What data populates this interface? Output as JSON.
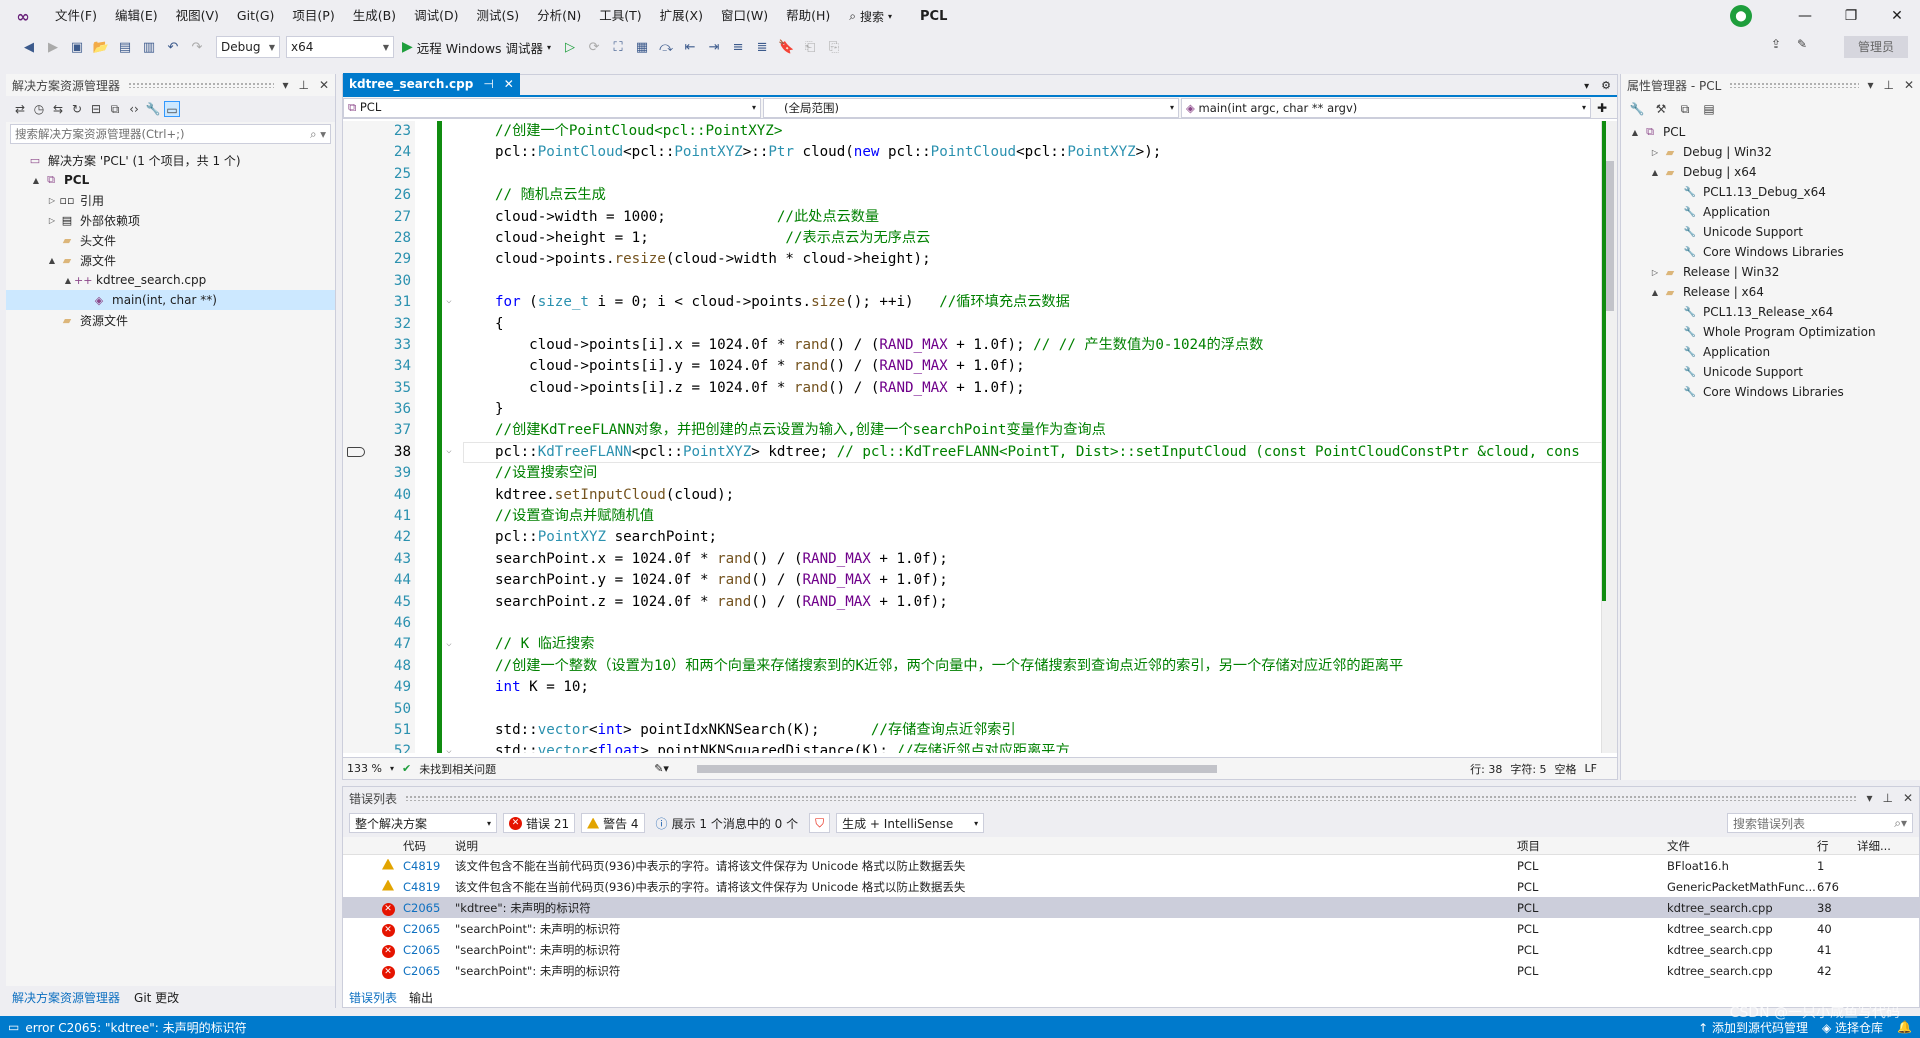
{
  "menu": {
    "items": [
      "文件(F)",
      "编辑(E)",
      "视图(V)",
      "Git(G)",
      "项目(P)",
      "生成(B)",
      "调试(D)",
      "测试(S)",
      "分析(N)",
      "工具(T)",
      "扩展(X)",
      "窗口(W)",
      "帮助(H)"
    ],
    "search_label": "搜索",
    "title": "PCL"
  },
  "toolbar": {
    "config": "Debug",
    "platform": "x64",
    "run_label": "远程 Windows 调试器",
    "manage_label": "管理员"
  },
  "solution_explorer": {
    "title": "解决方案资源管理器",
    "search_placeholder": "搜索解决方案资源管理器(Ctrl+;)",
    "tree": [
      {
        "label": "解决方案 'PCL' (1 个项目，共 1 个)",
        "indent": 0,
        "twisty": "",
        "icon": "solution-icon",
        "glyph": "▭",
        "bold": false
      },
      {
        "label": "PCL",
        "indent": 1,
        "twisty": "▲",
        "icon": "project-icon",
        "glyph": "⧉",
        "bold": true
      },
      {
        "label": "引用",
        "indent": 2,
        "twisty": "▷",
        "icon": "references-icon",
        "glyph": "▫▫",
        "bold": false
      },
      {
        "label": "外部依赖项",
        "indent": 2,
        "twisty": "▷",
        "icon": "external-deps-icon",
        "glyph": "▤",
        "bold": false
      },
      {
        "label": "头文件",
        "indent": 2,
        "twisty": "",
        "icon": "folder-icon",
        "glyph": "▰",
        "bold": false
      },
      {
        "label": "源文件",
        "indent": 2,
        "twisty": "▲",
        "icon": "folder-icon",
        "glyph": "▰",
        "bold": false
      },
      {
        "label": "kdtree_search.cpp",
        "indent": 3,
        "twisty": "▲",
        "icon": "cpp-file-icon",
        "glyph": "++",
        "bold": false
      },
      {
        "label": "main(int, char **)",
        "indent": 4,
        "twisty": "",
        "icon": "method-icon",
        "glyph": "◈",
        "bold": false,
        "selected": true
      },
      {
        "label": "资源文件",
        "indent": 2,
        "twisty": "",
        "icon": "folder-icon",
        "glyph": "▰",
        "bold": false
      }
    ],
    "bottom_tabs": [
      "解决方案资源管理器",
      "Git 更改"
    ]
  },
  "editor": {
    "tab_label": "kdtree_search.cpp",
    "nav_project": "PCL",
    "nav_scope": "(全局范围)",
    "nav_member": "main(int argc, char ** argv)",
    "current_line": 38,
    "lines": [
      {
        "n": 23,
        "fold": "",
        "segs": [
          [
            "cm",
            "//创建一个PointCloud<pcl::PointXYZ>"
          ]
        ]
      },
      {
        "n": 24,
        "fold": "",
        "segs": [
          [
            "nm",
            "pcl::"
          ],
          [
            "ty",
            "PointCloud"
          ],
          [
            "nm",
            "<pcl::"
          ],
          [
            "ty",
            "PointXYZ"
          ],
          [
            "nm",
            ">::"
          ],
          [
            "ty",
            "Ptr"
          ],
          [
            "nm",
            " cloud("
          ],
          [
            "kw",
            "new"
          ],
          [
            "nm",
            " pcl::"
          ],
          [
            "ty",
            "PointCloud"
          ],
          [
            "nm",
            "<pcl::"
          ],
          [
            "ty",
            "PointXYZ"
          ],
          [
            "nm",
            ">);"
          ]
        ]
      },
      {
        "n": 25,
        "fold": "",
        "segs": [
          [
            "nm",
            ""
          ]
        ]
      },
      {
        "n": 26,
        "fold": "",
        "segs": [
          [
            "cm",
            "// 随机点云生成"
          ]
        ]
      },
      {
        "n": 27,
        "fold": "",
        "segs": [
          [
            "nm",
            "cloud->width = 1000;             "
          ],
          [
            "cm",
            "//此处点云数量"
          ]
        ]
      },
      {
        "n": 28,
        "fold": "",
        "segs": [
          [
            "nm",
            "cloud->height = 1;                "
          ],
          [
            "cm",
            "//表示点云为无序点云"
          ]
        ]
      },
      {
        "n": 29,
        "fold": "",
        "segs": [
          [
            "nm",
            "cloud->points."
          ],
          [
            "fn",
            "resize"
          ],
          [
            "nm",
            "(cloud->width * cloud->height);"
          ]
        ]
      },
      {
        "n": 30,
        "fold": "",
        "segs": [
          [
            "nm",
            ""
          ]
        ]
      },
      {
        "n": 31,
        "fold": "⌵",
        "segs": [
          [
            "kw",
            "for"
          ],
          [
            "nm",
            " ("
          ],
          [
            "ty",
            "size_t"
          ],
          [
            "nm",
            " i = 0; i < cloud->points."
          ],
          [
            "fn",
            "size"
          ],
          [
            "nm",
            "(); ++i)   "
          ],
          [
            "cm",
            "//循环填充点云数据"
          ]
        ]
      },
      {
        "n": 32,
        "fold": "",
        "segs": [
          [
            "nm",
            "{"
          ]
        ]
      },
      {
        "n": 33,
        "fold": "",
        "segs": [
          [
            "nm",
            "    cloud->points[i].x = 1024.0f * "
          ],
          [
            "fn",
            "rand"
          ],
          [
            "nm",
            "() / ("
          ],
          [
            "mc",
            "RAND_MAX"
          ],
          [
            "nm",
            " + 1.0f); "
          ],
          [
            "cm",
            "// // 产生数值为0-1024的浮点数"
          ]
        ]
      },
      {
        "n": 34,
        "fold": "",
        "segs": [
          [
            "nm",
            "    cloud->points[i].y = 1024.0f * "
          ],
          [
            "fn",
            "rand"
          ],
          [
            "nm",
            "() / ("
          ],
          [
            "mc",
            "RAND_MAX"
          ],
          [
            "nm",
            " + 1.0f);"
          ]
        ]
      },
      {
        "n": 35,
        "fold": "",
        "segs": [
          [
            "nm",
            "    cloud->points[i].z = 1024.0f * "
          ],
          [
            "fn",
            "rand"
          ],
          [
            "nm",
            "() / ("
          ],
          [
            "mc",
            "RAND_MAX"
          ],
          [
            "nm",
            " + 1.0f);"
          ]
        ]
      },
      {
        "n": 36,
        "fold": "",
        "segs": [
          [
            "nm",
            "}"
          ]
        ]
      },
      {
        "n": 37,
        "fold": "",
        "segs": [
          [
            "cm",
            "//创建KdTreeFLANN对象，并把创建的点云设置为输入,创建一个searchPoint变量作为查询点"
          ]
        ]
      },
      {
        "n": 38,
        "fold": "⌵",
        "segs": [
          [
            "nm",
            "pcl::"
          ],
          [
            "ty",
            "KdTreeFLANN"
          ],
          [
            "nm",
            "<pcl::"
          ],
          [
            "ty",
            "PointXYZ"
          ],
          [
            "nm",
            "> kdtree; "
          ],
          [
            "cm",
            "// pcl::KdTreeFLANN<PointT, Dist>::setInputCloud (const PointCloudConstPtr &cloud, cons"
          ]
        ]
      },
      {
        "n": 39,
        "fold": "",
        "segs": [
          [
            "cm",
            "//设置搜索空间"
          ]
        ]
      },
      {
        "n": 40,
        "fold": "",
        "segs": [
          [
            "nm",
            "kdtree."
          ],
          [
            "fn",
            "setInputCloud"
          ],
          [
            "nm",
            "(cloud);"
          ]
        ]
      },
      {
        "n": 41,
        "fold": "",
        "segs": [
          [
            "cm",
            "//设置查询点并赋随机值"
          ]
        ]
      },
      {
        "n": 42,
        "fold": "",
        "segs": [
          [
            "nm",
            "pcl::"
          ],
          [
            "ty",
            "PointXYZ"
          ],
          [
            "nm",
            " searchPoint;"
          ]
        ]
      },
      {
        "n": 43,
        "fold": "",
        "segs": [
          [
            "nm",
            "searchPoint.x = 1024.0f * "
          ],
          [
            "fn",
            "rand"
          ],
          [
            "nm",
            "() / ("
          ],
          [
            "mc",
            "RAND_MAX"
          ],
          [
            "nm",
            " + 1.0f);"
          ]
        ]
      },
      {
        "n": 44,
        "fold": "",
        "segs": [
          [
            "nm",
            "searchPoint.y = 1024.0f * "
          ],
          [
            "fn",
            "rand"
          ],
          [
            "nm",
            "() / ("
          ],
          [
            "mc",
            "RAND_MAX"
          ],
          [
            "nm",
            " + 1.0f);"
          ]
        ]
      },
      {
        "n": 45,
        "fold": "",
        "segs": [
          [
            "nm",
            "searchPoint.z = 1024.0f * "
          ],
          [
            "fn",
            "rand"
          ],
          [
            "nm",
            "() / ("
          ],
          [
            "mc",
            "RAND_MAX"
          ],
          [
            "nm",
            " + 1.0f);"
          ]
        ]
      },
      {
        "n": 46,
        "fold": "",
        "segs": [
          [
            "nm",
            ""
          ]
        ]
      },
      {
        "n": 47,
        "fold": "⌵",
        "segs": [
          [
            "cm",
            "// K 临近搜索"
          ]
        ]
      },
      {
        "n": 48,
        "fold": "",
        "segs": [
          [
            "cm",
            "//创建一个整数（设置为10）和两个向量来存储搜索到的K近邻，两个向量中，一个存储搜索到查询点近邻的索引，另一个存储对应近邻的距离平"
          ]
        ]
      },
      {
        "n": 49,
        "fold": "",
        "segs": [
          [
            "kw",
            "int"
          ],
          [
            "nm",
            " K = 10;"
          ]
        ]
      },
      {
        "n": 50,
        "fold": "",
        "segs": [
          [
            "nm",
            ""
          ]
        ]
      },
      {
        "n": 51,
        "fold": "",
        "segs": [
          [
            "nm",
            "std::"
          ],
          [
            "ty",
            "vector"
          ],
          [
            "nm",
            "<"
          ],
          [
            "kw",
            "int"
          ],
          [
            "nm",
            "> pointIdxNKNSearch(K);      "
          ],
          [
            "cm",
            "//存储查询点近邻索引"
          ]
        ]
      },
      {
        "n": 52,
        "fold": "⌵",
        "segs": [
          [
            "nm",
            "std::"
          ],
          [
            "ty",
            "vector"
          ],
          [
            "nm",
            "<"
          ],
          [
            "kw",
            "float"
          ],
          [
            "nm",
            "> pointNKNSquaredDistance(K); "
          ],
          [
            "cm",
            "//存储近邻点对应距离平方"
          ]
        ]
      }
    ],
    "status": {
      "zoom": "133 %",
      "issues": "未找到相关问题",
      "row": "行: 38",
      "col": "字符: 5",
      "indent": "空格",
      "eol": "LF"
    }
  },
  "properties": {
    "title": "属性管理器 - PCL",
    "tree": [
      {
        "label": "PCL",
        "indent": 0,
        "twisty": "▲",
        "icon": "project-icon",
        "glyph": "⧉"
      },
      {
        "label": "Debug | Win32",
        "indent": 1,
        "twisty": "▷",
        "icon": "folder-icon",
        "glyph": "▰"
      },
      {
        "label": "Debug | x64",
        "indent": 1,
        "twisty": "▲",
        "icon": "folder-icon",
        "glyph": "▰"
      },
      {
        "label": "PCL1.13_Debug_x64",
        "indent": 2,
        "twisty": "",
        "icon": "wrench-icon",
        "glyph": "🔧"
      },
      {
        "label": "Application",
        "indent": 2,
        "twisty": "",
        "icon": "wrench-icon",
        "glyph": "🔧"
      },
      {
        "label": "Unicode Support",
        "indent": 2,
        "twisty": "",
        "icon": "wrench-icon",
        "glyph": "🔧"
      },
      {
        "label": "Core Windows Libraries",
        "indent": 2,
        "twisty": "",
        "icon": "wrench-icon",
        "glyph": "🔧"
      },
      {
        "label": "Release | Win32",
        "indent": 1,
        "twisty": "▷",
        "icon": "folder-icon",
        "glyph": "▰"
      },
      {
        "label": "Release | x64",
        "indent": 1,
        "twisty": "▲",
        "icon": "folder-icon",
        "glyph": "▰"
      },
      {
        "label": "PCL1.13_Release_x64",
        "indent": 2,
        "twisty": "",
        "icon": "wrench-icon",
        "glyph": "🔧"
      },
      {
        "label": "Whole Program Optimization",
        "indent": 2,
        "twisty": "",
        "icon": "wrench-icon",
        "glyph": "🔧"
      },
      {
        "label": "Application",
        "indent": 2,
        "twisty": "",
        "icon": "wrench-icon",
        "glyph": "🔧"
      },
      {
        "label": "Unicode Support",
        "indent": 2,
        "twisty": "",
        "icon": "wrench-icon",
        "glyph": "🔧"
      },
      {
        "label": "Core Windows Libraries",
        "indent": 2,
        "twisty": "",
        "icon": "wrench-icon",
        "glyph": "🔧"
      }
    ]
  },
  "errors": {
    "title": "错误列表",
    "scope": "整个解决方案",
    "errors_btn": "错误 21",
    "warnings_btn": "警告 4",
    "messages_btn": "展示 1 个消息中的 0 个",
    "source": "生成 + IntelliSense",
    "search_placeholder": "搜索错误列表",
    "headers": {
      "code": "代码",
      "desc": "说明",
      "project": "项目",
      "file": "文件",
      "line": "行",
      "detail": "详细..."
    },
    "rows": [
      {
        "type": "warning",
        "code": "C4819",
        "desc": "该文件包含不能在当前代码页(936)中表示的字符。请将该文件保存为 Unicode 格式以防止数据丢失",
        "project": "PCL",
        "file": "BFloat16.h",
        "line": "1"
      },
      {
        "type": "warning",
        "code": "C4819",
        "desc": "该文件包含不能在当前代码页(936)中表示的字符。请将该文件保存为 Unicode 格式以防止数据丢失",
        "project": "PCL",
        "file": "GenericPacketMathFunc...",
        "line": "676"
      },
      {
        "type": "error",
        "code": "C2065",
        "desc": "\"kdtree\": 未声明的标识符",
        "project": "PCL",
        "file": "kdtree_search.cpp",
        "line": "38",
        "selected": true
      },
      {
        "type": "error",
        "code": "C2065",
        "desc": "\"searchPoint\": 未声明的标识符",
        "project": "PCL",
        "file": "kdtree_search.cpp",
        "line": "40"
      },
      {
        "type": "error",
        "code": "C2065",
        "desc": "\"searchPoint\": 未声明的标识符",
        "project": "PCL",
        "file": "kdtree_search.cpp",
        "line": "41"
      },
      {
        "type": "error",
        "code": "C2065",
        "desc": "\"searchPoint\": 未声明的标识符",
        "project": "PCL",
        "file": "kdtree_search.cpp",
        "line": "42"
      }
    ],
    "bottom_tabs": [
      "错误列表",
      "输出"
    ]
  },
  "statusbar": {
    "message": "error C2065: \"kdtree\": 未声明的标识符",
    "source_control": "添加到源代码管理",
    "repo": "选择仓库",
    "watermark": "CSDN @一只小咸鱼写代码"
  },
  "colors": {
    "accent": "#007ACC",
    "change_bar": "#108C10",
    "error": "#E51400",
    "warning": "#E2A400"
  }
}
